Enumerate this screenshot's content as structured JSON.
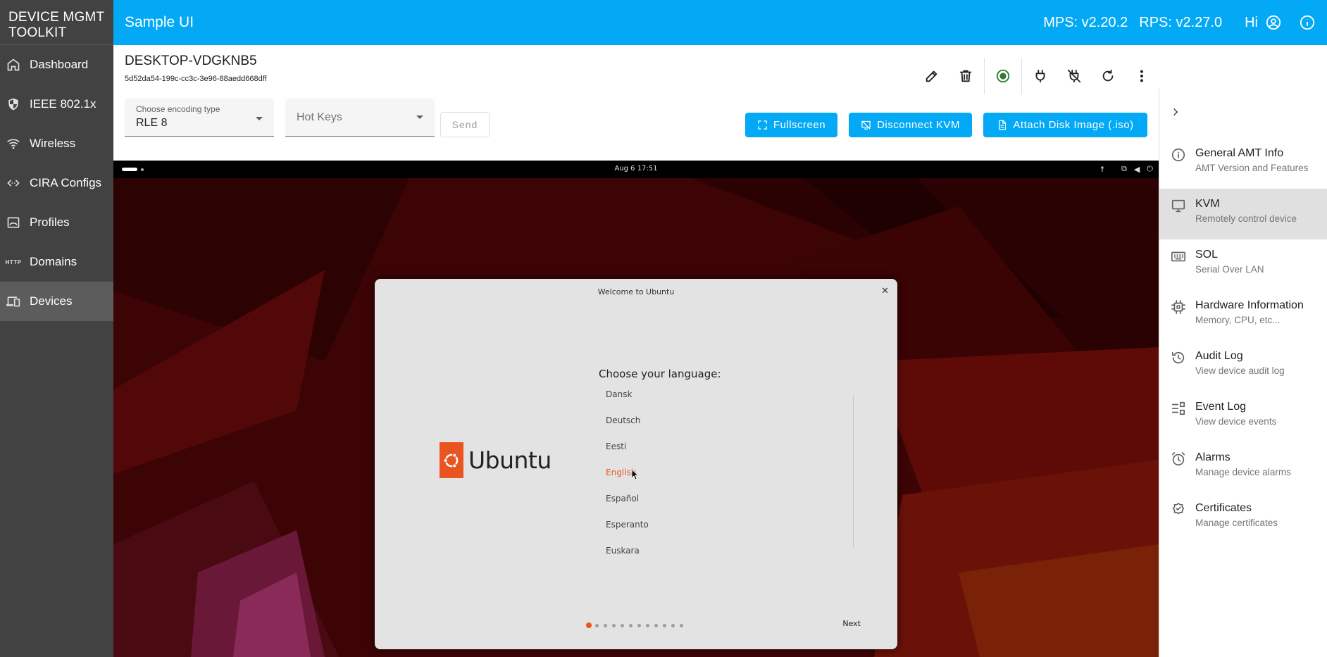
{
  "sidebar": {
    "brand": "DEVICE MGMT\nTOOLKIT",
    "items": [
      {
        "label": "Dashboard",
        "icon": "home-icon"
      },
      {
        "label": "IEEE 802.1x",
        "icon": "shield-icon"
      },
      {
        "label": "Wireless",
        "icon": "wifi-icon"
      },
      {
        "label": "CIRA Configs",
        "icon": "code-icon"
      },
      {
        "label": "Profiles",
        "icon": "profile-icon"
      },
      {
        "label": "Domains",
        "icon": "http-icon",
        "tag": "HTTP"
      },
      {
        "label": "Devices",
        "icon": "devices-icon",
        "active": true
      }
    ]
  },
  "header": {
    "title": "Sample UI",
    "mps_version": "MPS: v2.20.2",
    "rps_version": "RPS: v2.27.0",
    "greeting": "Hi",
    "accent": "#03a9f4"
  },
  "device": {
    "name": "DESKTOP-VDGKNB5",
    "guid": "5d52da54-199c-cc3c-3e96-88aedd668dff",
    "power_state_color": "#2e7d32"
  },
  "toolbar": {
    "encoding_label": "Choose encoding type",
    "encoding_value": "RLE 8",
    "hotkeys_placeholder": "Hot Keys",
    "send_label": "Send",
    "fullscreen_label": "Fullscreen",
    "disconnect_label": "Disconnect KVM",
    "attach_label": "Attach Disk Image (.iso)"
  },
  "kvm_screen": {
    "clock": "Aug 6  17:51",
    "window_title": "Welcome to Ubuntu",
    "close_glyph": "✕",
    "brand_word": "Ubuntu",
    "language_heading": "Choose your language:",
    "languages": [
      "Dansk",
      "Deutsch",
      "Eesti",
      "English",
      "Español",
      "Esperanto",
      "Euskara"
    ],
    "selected_language": "English",
    "step_index": 1,
    "step_count": 12,
    "next_label": "Next"
  },
  "right_panel": {
    "items": [
      {
        "title": "General AMT Info",
        "subtitle": "AMT Version and Features",
        "icon": "info-icon"
      },
      {
        "title": "KVM",
        "subtitle": "Remotely control device",
        "icon": "monitor-icon",
        "active": true
      },
      {
        "title": "SOL",
        "subtitle": "Serial Over LAN",
        "icon": "keyboard-icon"
      },
      {
        "title": "Hardware Information",
        "subtitle": "Memory, CPU, etc...",
        "icon": "chip-icon"
      },
      {
        "title": "Audit Log",
        "subtitle": "View device audit log",
        "icon": "history-icon"
      },
      {
        "title": "Event Log",
        "subtitle": "View device events",
        "icon": "list-icon"
      },
      {
        "title": "Alarms",
        "subtitle": "Manage device alarms",
        "icon": "alarm-icon"
      },
      {
        "title": "Certificates",
        "subtitle": "Manage certificates",
        "icon": "certificate-icon"
      }
    ]
  }
}
